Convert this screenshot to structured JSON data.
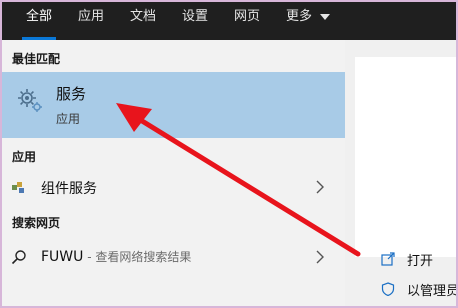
{
  "tabs": [
    {
      "label": "全部",
      "active": true
    },
    {
      "label": "应用"
    },
    {
      "label": "文档"
    },
    {
      "label": "设置"
    },
    {
      "label": "网页"
    },
    {
      "label": "更多"
    }
  ],
  "best_match": {
    "header": "最佳匹配",
    "title": "服务",
    "subtitle": "应用",
    "icon": "gear-icon"
  },
  "apps": {
    "header": "应用",
    "items": [
      {
        "label": "组件服务",
        "icon": "component-services-icon"
      }
    ]
  },
  "web": {
    "header": "搜索网页",
    "items": [
      {
        "label": "FUWU",
        "suffix": " - 查看网络搜索结果",
        "icon": "search-icon"
      }
    ]
  },
  "preview": {
    "actions": [
      {
        "label": "打开",
        "icon": "open-icon"
      },
      {
        "label": "以管理员",
        "icon": "shield-icon"
      }
    ]
  },
  "colors": {
    "topbar": "#1f1f1f",
    "accent": "#0a78d7",
    "selected": "#a8cbe7",
    "annotation_arrow": "#e8141c",
    "frame_border": "#d7b6d9"
  }
}
